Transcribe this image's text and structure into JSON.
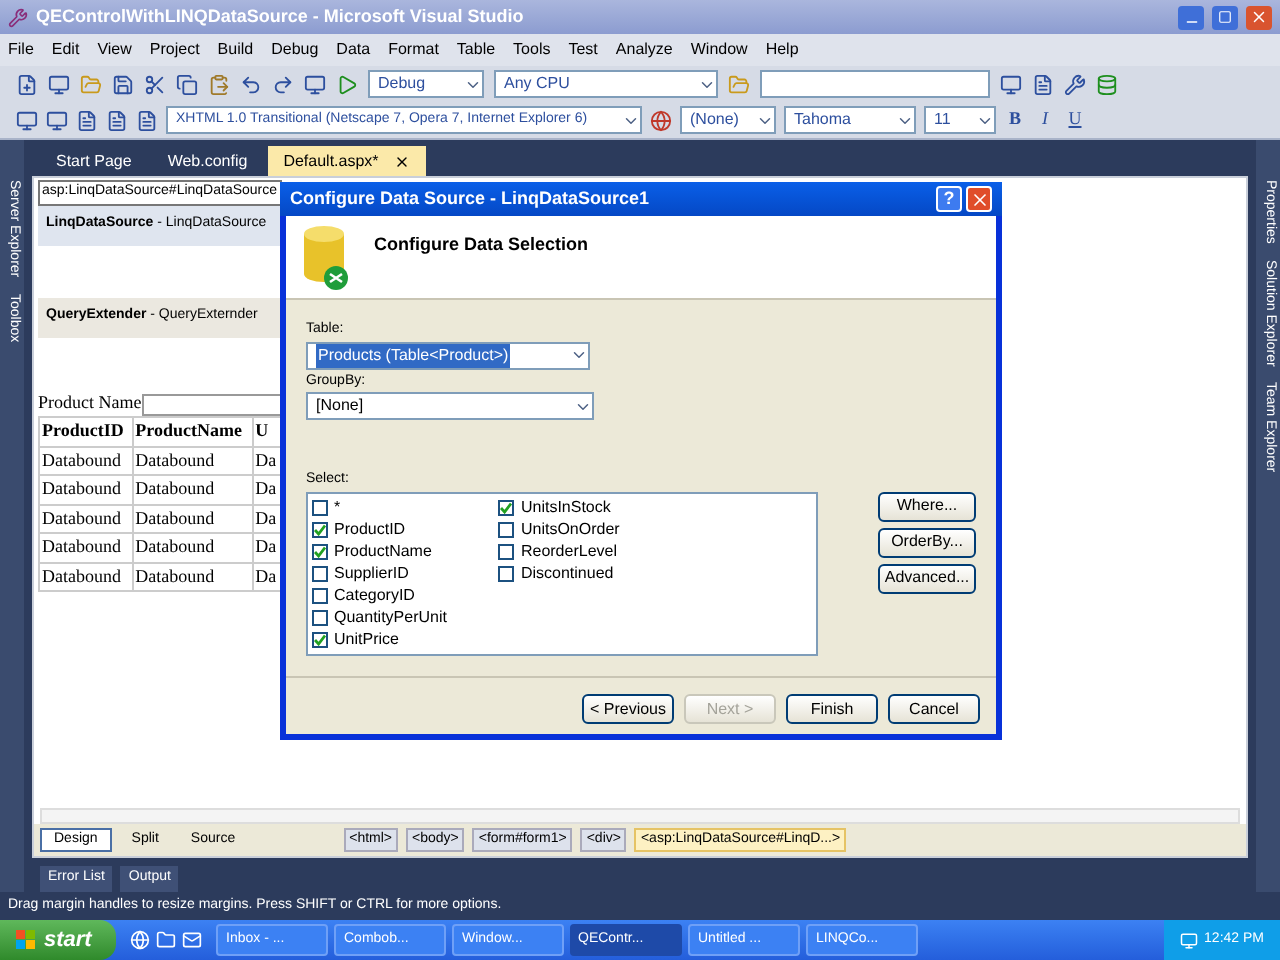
{
  "window": {
    "title": "QEControlWithLINQDataSource - Microsoft Visual Studio"
  },
  "menu": [
    "File",
    "Edit",
    "View",
    "Project",
    "Build",
    "Debug",
    "Data",
    "Format",
    "Table",
    "Tools",
    "Test",
    "Analyze",
    "Window",
    "Help"
  ],
  "standard_toolbar": {
    "configuration": "Debug",
    "platform": "Any CPU"
  },
  "format_toolbar": {
    "doctype": "XHTML 1.0 Transitional (Netscape 7, Opera 7, Internet Explorer 6)",
    "style": "(None)",
    "font": "Tahoma",
    "size": "11",
    "buttons": [
      "B",
      "I",
      "U"
    ]
  },
  "left_panels": [
    "Server Explorer",
    "Toolbox"
  ],
  "right_panels": [
    "Properties",
    "Solution Explorer",
    "Team Explorer"
  ],
  "tabs": [
    {
      "label": "Start Page",
      "selected": false
    },
    {
      "label": "Web.config",
      "selected": false
    },
    {
      "label": "Default.aspx*",
      "selected": true
    }
  ],
  "designer": {
    "tag_label": "asp:LinqDataSource#LinqDataSource",
    "controls": [
      "**LinqDataSource** - LinqDataSource",
      "**QueryExtender** - QueryExternder"
    ],
    "filter_label": "Product Name",
    "table": {
      "columns": [
        "ProductID",
        "ProductName",
        "U"
      ],
      "rows": [
        [
          "Databound",
          "Databound",
          "Da"
        ],
        [
          "Databound",
          "Databound",
          "Da"
        ],
        [
          "Databound",
          "Databound",
          "Da"
        ],
        [
          "Databound",
          "Databound",
          "Da"
        ],
        [
          "Databound",
          "Databound",
          "Da"
        ]
      ]
    }
  },
  "view_tabs": [
    {
      "label": "Design",
      "selected": true
    },
    {
      "label": "Split",
      "selected": false
    },
    {
      "label": "Source",
      "selected": false
    }
  ],
  "breadcrumbs": [
    {
      "label": "<html>",
      "selected": false
    },
    {
      "label": "<body>",
      "selected": false
    },
    {
      "label": "<form#form1>",
      "selected": false
    },
    {
      "label": "<div>",
      "selected": false
    },
    {
      "label": "<asp:LinqDataSource#LinqD...>",
      "selected": true
    }
  ],
  "tool_tabs": [
    "Error List",
    "Output"
  ],
  "status_bar": "Drag margin handles to resize margins. Press SHIFT or CTRL for more options.",
  "dialog": {
    "title": "Configure Data Source - LinqDataSource1",
    "help": "?",
    "heading": "Configure Data Selection",
    "table_label": "Table:",
    "table_value": "Products (Table<Product>)",
    "groupby_label": "GroupBy:",
    "groupby_value": "[None]",
    "select_label": "Select:",
    "columns": [
      [
        {
          "label": "*",
          "checked": false
        },
        {
          "label": "ProductID",
          "checked": true
        },
        {
          "label": "ProductName",
          "checked": true
        },
        {
          "label": "SupplierID",
          "checked": false
        },
        {
          "label": "CategoryID",
          "checked": false
        },
        {
          "label": "QuantityPerUnit",
          "checked": false
        },
        {
          "label": "UnitPrice",
          "checked": true
        }
      ],
      [
        {
          "label": "UnitsInStock",
          "checked": true
        },
        {
          "label": "UnitsOnOrder",
          "checked": false
        },
        {
          "label": "ReorderLevel",
          "checked": false
        },
        {
          "label": "Discontinued",
          "checked": false
        }
      ]
    ],
    "side_buttons": [
      "Where...",
      "OrderBy...",
      "Advanced..."
    ],
    "footer_buttons": [
      {
        "label": "< Previous",
        "disabled": false
      },
      {
        "label": "Next >",
        "disabled": true
      },
      {
        "label": "Finish",
        "disabled": false
      },
      {
        "label": "Cancel",
        "disabled": false
      }
    ]
  },
  "taskbar": {
    "start": "start",
    "tasks": [
      {
        "label": "Inbox - ...",
        "selected": false
      },
      {
        "label": "Combob...",
        "selected": false
      },
      {
        "label": "Window...",
        "selected": false
      },
      {
        "label": "QEContr...",
        "selected": true
      },
      {
        "label": "Untitled ...",
        "selected": false
      },
      {
        "label": "LINQCo...",
        "selected": false
      }
    ],
    "clock": "12:42 PM"
  }
}
